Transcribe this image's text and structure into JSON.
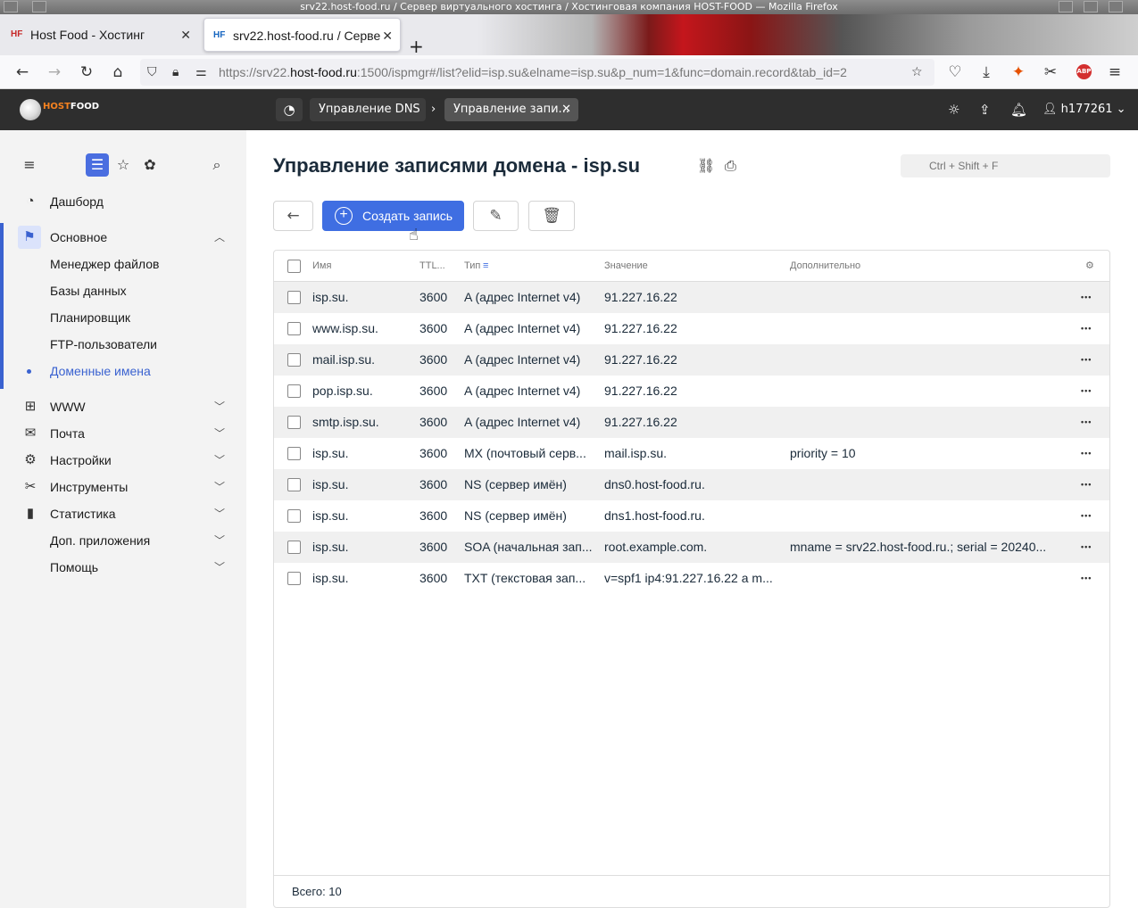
{
  "window": {
    "title": "srv22.host-food.ru / Сервер виртуального хостинга / Хостинговая компания HOST-FOOD — Mozilla Firefox"
  },
  "browser": {
    "tabs": [
      {
        "label": "Host Food - Хостинг",
        "favicon": "HF"
      },
      {
        "label": "srv22.host-food.ru / Серве",
        "favicon": "HF"
      }
    ],
    "url_scheme": "https://srv22.",
    "url_host": "host-food.ru",
    "url_rest": ":1500/ispmgr#/list?elid=isp.su&elname=isp.su&p_num=1&func=domain.record&tab_id=2",
    "abp_label": "ABP"
  },
  "header": {
    "logo_host": "HOST",
    "logo_food": "FOOD",
    "breadcrumbs": [
      "Управление DNS",
      "Управление запи..."
    ],
    "username": "h177261"
  },
  "sidebar": {
    "items": [
      {
        "label": "Дашборд",
        "icon": "dashboard-icon"
      },
      {
        "label": "Основное",
        "icon": "flag-icon"
      },
      {
        "label": "Менеджер файлов"
      },
      {
        "label": "Базы данных"
      },
      {
        "label": "Планировщик"
      },
      {
        "label": "FTP-пользователи"
      },
      {
        "label": "Доменные имена"
      },
      {
        "label": "WWW",
        "icon": "www-icon"
      },
      {
        "label": "Почта",
        "icon": "mail-icon"
      },
      {
        "label": "Настройки",
        "icon": "settings-icon"
      },
      {
        "label": "Инструменты",
        "icon": "tools-icon"
      },
      {
        "label": "Статистика",
        "icon": "stats-icon"
      },
      {
        "label": "Доп. приложения"
      },
      {
        "label": "Помощь"
      }
    ]
  },
  "main": {
    "title": "Управление записями домена - isp.su",
    "search_placeholder": "Ctrl + Shift + F",
    "create_label": "Создать запись",
    "columns": [
      "Имя",
      "TTL...",
      "Тип",
      "Значение",
      "Дополнительно"
    ],
    "rows": [
      {
        "name": "isp.su.",
        "ttl": "3600",
        "type": "A (адрес Internet v4)",
        "value": "91.227.16.22",
        "extra": ""
      },
      {
        "name": "www.isp.su.",
        "ttl": "3600",
        "type": "A (адрес Internet v4)",
        "value": "91.227.16.22",
        "extra": ""
      },
      {
        "name": "mail.isp.su.",
        "ttl": "3600",
        "type": "A (адрес Internet v4)",
        "value": "91.227.16.22",
        "extra": ""
      },
      {
        "name": "pop.isp.su.",
        "ttl": "3600",
        "type": "A (адрес Internet v4)",
        "value": "91.227.16.22",
        "extra": ""
      },
      {
        "name": "smtp.isp.su.",
        "ttl": "3600",
        "type": "A (адрес Internet v4)",
        "value": "91.227.16.22",
        "extra": ""
      },
      {
        "name": "isp.su.",
        "ttl": "3600",
        "type": "MX (почтовый серв...",
        "value": "mail.isp.su.",
        "extra": "priority = 10"
      },
      {
        "name": "isp.su.",
        "ttl": "3600",
        "type": "NS (сервер имён)",
        "value": "dns0.host-food.ru.",
        "extra": ""
      },
      {
        "name": "isp.su.",
        "ttl": "3600",
        "type": "NS (сервер имён)",
        "value": "dns1.host-food.ru.",
        "extra": ""
      },
      {
        "name": "isp.su.",
        "ttl": "3600",
        "type": "SOA (начальная зап...",
        "value": "root.example.com.",
        "extra": "mname = srv22.host-food.ru.; serial = 20240..."
      },
      {
        "name": "isp.su.",
        "ttl": "3600",
        "type": "TXT (текстовая зап...",
        "value": "v=spf1 ip4:91.227.16.22 a m...",
        "extra": ""
      }
    ],
    "total_label": "Всего: 10"
  },
  "colors": {
    "accent": "#3f6ee2",
    "header_bg": "#2e2e2e",
    "sidebar_bg": "#f3f3f3"
  }
}
